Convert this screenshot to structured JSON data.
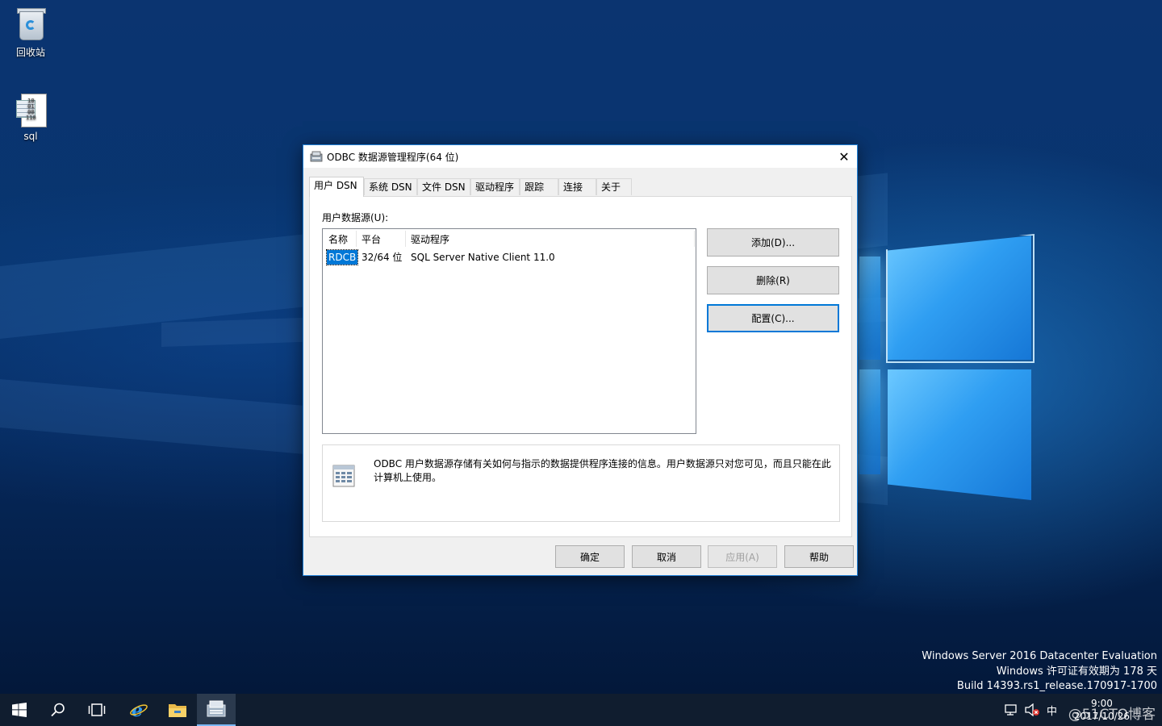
{
  "desktop": {
    "icons": [
      {
        "label": "回收站"
      },
      {
        "label": "sql"
      }
    ],
    "watermark": {
      "line1": "Windows Server 2016 Datacenter Evaluation",
      "line2": "Windows 许可证有效期为 178 天",
      "line3": "Build 14393.rs1_release.170917-1700"
    }
  },
  "dialog": {
    "title": "ODBC 数据源管理程序(64 位)",
    "close_glyph": "✕",
    "tabs": [
      {
        "label": "用户 DSN",
        "active": true
      },
      {
        "label": "系统 DSN"
      },
      {
        "label": "文件 DSN"
      },
      {
        "label": "驱动程序"
      },
      {
        "label": "跟踪"
      },
      {
        "label": "连接池"
      },
      {
        "label": "关于"
      }
    ],
    "list_label": "用户数据源(U):",
    "columns": [
      "名称",
      "平台",
      "驱动程序"
    ],
    "rows": [
      {
        "name": "RDCB",
        "platform": "32/64 位",
        "driver": "SQL Server Native Client 11.0",
        "selected": true
      }
    ],
    "side_buttons": {
      "add": "添加(D)...",
      "remove": "删除(R)",
      "configure": "配置(C)..."
    },
    "info_text": "ODBC 用户数据源存储有关如何与指示的数据提供程序连接的信息。用户数据源只对您可见，而且只能在此计算机上使用。",
    "footer_buttons": {
      "ok": "确定",
      "cancel": "取消",
      "apply": "应用(A)",
      "help": "帮助"
    }
  },
  "taskbar": {
    "icons": [
      "windows-start-icon",
      "search-icon",
      "task-view-icon",
      "internet-explorer-icon",
      "file-explorer-icon",
      "odbc-admin-icon"
    ],
    "tray": {
      "ime": "中",
      "time": "9:00",
      "date": "2017/10/26"
    },
    "overlay_watermark": "@51CTO博客"
  },
  "colors": {
    "accent": "#0078d7",
    "taskbar": "#101d2f",
    "dialog_bg": "#f0f0f0"
  }
}
